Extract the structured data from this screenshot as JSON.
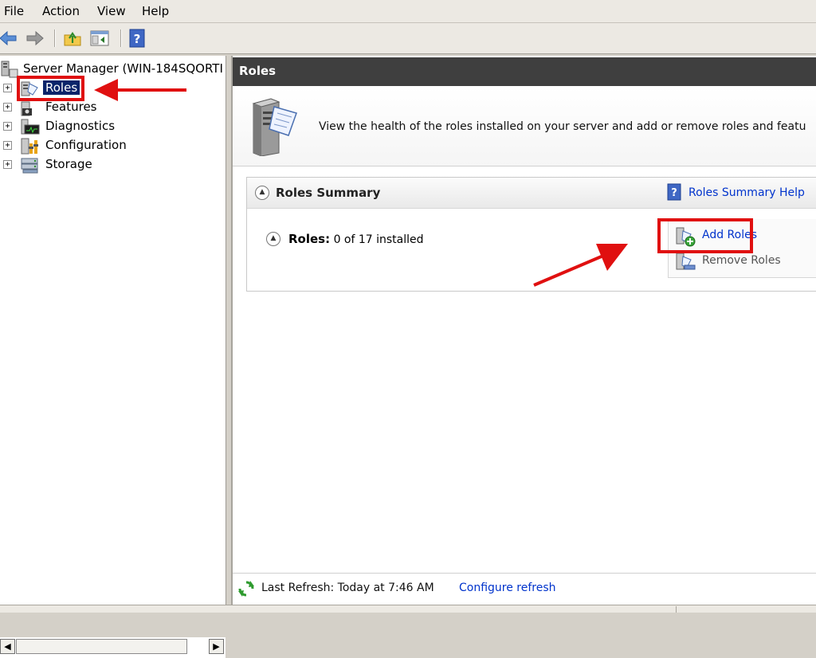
{
  "menu": [
    "File",
    "Action",
    "View",
    "Help"
  ],
  "toolbar": {
    "icons": [
      "back-arrow-icon",
      "forward-arrow-icon",
      "up-folder-icon",
      "show-hide-console-tree-icon",
      "help-icon"
    ]
  },
  "tree": {
    "root": "Server Manager (WIN-184SQORTI",
    "items": [
      {
        "label": "Roles",
        "icon": "roles-icon",
        "selected": true
      },
      {
        "label": "Features",
        "icon": "features-icon"
      },
      {
        "label": "Diagnostics",
        "icon": "diagnostics-icon"
      },
      {
        "label": "Configuration",
        "icon": "configuration-icon"
      },
      {
        "label": "Storage",
        "icon": "storage-icon"
      }
    ],
    "expander_glyph": "+"
  },
  "pane": {
    "title": "Roles",
    "intro_text": "View the health of the roles installed on your server and add or remove roles and featu"
  },
  "summary": {
    "title": "Roles Summary",
    "help_link": "Roles Summary Help",
    "roles_label": "Roles:",
    "roles_count": "0 of 17 installed",
    "add_roles": "Add Roles",
    "remove_roles": "Remove Roles"
  },
  "status": {
    "last_refresh": "Last Refresh: Today at 7:46 AM",
    "configure_refresh": "Configure refresh"
  },
  "colors": {
    "highlight_box": "#e01010",
    "link": "#0033cc",
    "header_bar": "#3f3f3f",
    "selection": "#0a246a"
  }
}
